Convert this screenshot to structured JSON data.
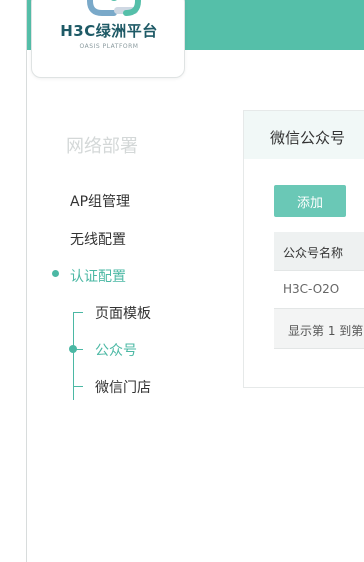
{
  "logo": {
    "title": "H3C绿洲平台",
    "subtitle": "OASIS PLATFORM"
  },
  "sidebar": {
    "heading": "网络部署",
    "items": [
      {
        "label": "AP组管理"
      },
      {
        "label": "无线配置"
      },
      {
        "label": "认证配置",
        "active": true
      }
    ],
    "subitems": [
      {
        "label": "页面模板"
      },
      {
        "label": "公众号",
        "active": true
      },
      {
        "label": "微信门店"
      }
    ]
  },
  "panel": {
    "title": "微信公众号",
    "add_button": "添加",
    "table": {
      "headers": [
        "公众号名称"
      ],
      "rows": [
        [
          "H3C-O2O"
        ]
      ]
    },
    "pager_text": "显示第 1 到第"
  },
  "colors": {
    "accent": "#55bfa9",
    "active_text": "#4bb8a4",
    "button": "#6ac8b6"
  }
}
